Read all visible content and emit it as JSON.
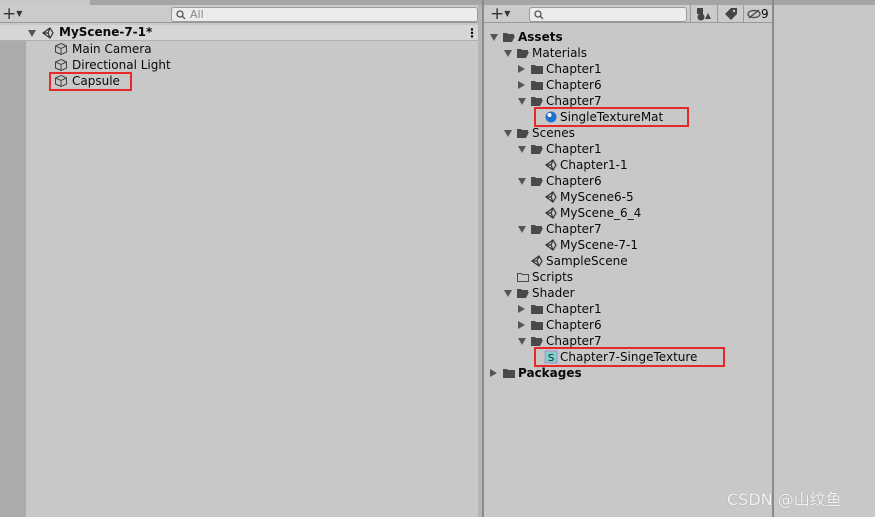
{
  "hierarchy": {
    "search_placeholder": "All",
    "scene": {
      "label": "MyScene-7-1*",
      "icon": "unity-scene-icon"
    },
    "items": [
      {
        "label": "Main Camera",
        "icon": "gameobject-cube-icon",
        "highlight": false
      },
      {
        "label": "Directional Light",
        "icon": "gameobject-cube-icon",
        "highlight": false
      },
      {
        "label": "Capsule",
        "icon": "gameobject-cube-icon",
        "highlight": true
      }
    ]
  },
  "project": {
    "hidden_count": "9",
    "tree": [
      {
        "label": "Assets",
        "depth": 0,
        "arrow": "down",
        "icon": "folder-open",
        "bold": true
      },
      {
        "label": "Materials",
        "depth": 1,
        "arrow": "down",
        "icon": "folder-open"
      },
      {
        "label": "Chapter1",
        "depth": 2,
        "arrow": "right",
        "icon": "folder"
      },
      {
        "label": "Chapter6",
        "depth": 2,
        "arrow": "right",
        "icon": "folder"
      },
      {
        "label": "Chapter7",
        "depth": 2,
        "arrow": "down",
        "icon": "folder-open"
      },
      {
        "label": "SingleTextureMat",
        "depth": 3,
        "arrow": "none",
        "icon": "material",
        "highlight": true
      },
      {
        "label": "Scenes",
        "depth": 1,
        "arrow": "down",
        "icon": "folder-open"
      },
      {
        "label": "Chapter1",
        "depth": 2,
        "arrow": "down",
        "icon": "folder-open"
      },
      {
        "label": "Chapter1-1",
        "depth": 3,
        "arrow": "none",
        "icon": "scene"
      },
      {
        "label": "Chapter6",
        "depth": 2,
        "arrow": "down",
        "icon": "folder-open"
      },
      {
        "label": "MyScene6-5",
        "depth": 3,
        "arrow": "none",
        "icon": "scene"
      },
      {
        "label": "MyScene_6_4",
        "depth": 3,
        "arrow": "none",
        "icon": "scene"
      },
      {
        "label": "Chapter7",
        "depth": 2,
        "arrow": "down",
        "icon": "folder-open"
      },
      {
        "label": "MyScene-7-1",
        "depth": 3,
        "arrow": "none",
        "icon": "scene"
      },
      {
        "label": "SampleScene",
        "depth": 2,
        "arrow": "none",
        "icon": "scene"
      },
      {
        "label": "Scripts",
        "depth": 1,
        "arrow": "none",
        "icon": "folder-empty"
      },
      {
        "label": "Shader",
        "depth": 1,
        "arrow": "down",
        "icon": "folder-open"
      },
      {
        "label": "Chapter1",
        "depth": 2,
        "arrow": "right",
        "icon": "folder"
      },
      {
        "label": "Chapter6",
        "depth": 2,
        "arrow": "right",
        "icon": "folder"
      },
      {
        "label": "Chapter7",
        "depth": 2,
        "arrow": "down",
        "icon": "folder-open"
      },
      {
        "label": "Chapter7-SingeTexture",
        "depth": 3,
        "arrow": "none",
        "icon": "shader",
        "highlight": true
      },
      {
        "label": "Packages",
        "depth": 0,
        "arrow": "right",
        "icon": "folder",
        "bold": true
      }
    ]
  },
  "watermark": "CSDN @山纹鱼",
  "colors": {
    "highlight": "#e8292a",
    "material": "#1f6fd0"
  }
}
